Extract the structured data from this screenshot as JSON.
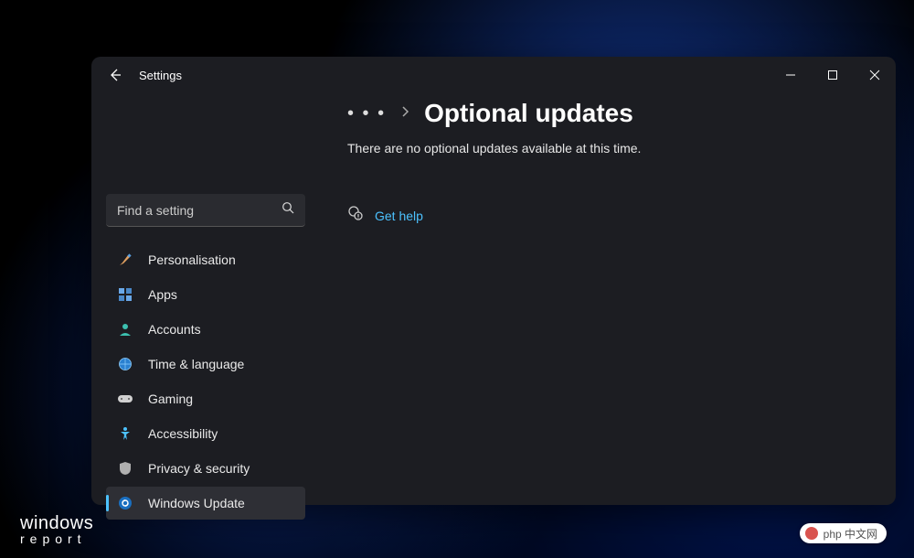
{
  "window": {
    "title": "Settings"
  },
  "search": {
    "placeholder": "Find a setting"
  },
  "nav": {
    "items": [
      {
        "label": "Personalisation"
      },
      {
        "label": "Apps"
      },
      {
        "label": "Accounts"
      },
      {
        "label": "Time & language"
      },
      {
        "label": "Gaming"
      },
      {
        "label": "Accessibility"
      },
      {
        "label": "Privacy & security"
      },
      {
        "label": "Windows Update"
      }
    ],
    "selected_index": 7
  },
  "breadcrumb": {
    "ellipsis": "• • •",
    "page_title": "Optional updates"
  },
  "status": {
    "message": "There are no optional updates available at this time."
  },
  "help": {
    "label": "Get help"
  },
  "watermark": {
    "line1": "windows",
    "line2": "report"
  },
  "badge": {
    "text": "php 中文网"
  },
  "colors": {
    "accent": "#4cc2ff",
    "window_bg": "#1c1d22",
    "search_bg": "#2a2b30",
    "selected_bg": "#2e2f35"
  }
}
